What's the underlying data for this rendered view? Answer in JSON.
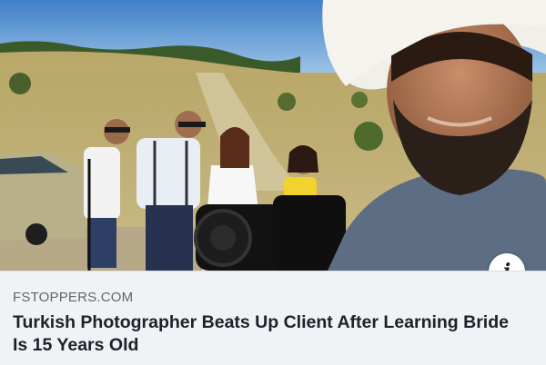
{
  "card": {
    "domain": "FSTOPPERS.COM",
    "headline": "Turkish Photographer Beats Up Client After Learning Bride Is 15 Years Old",
    "info_icon": "i"
  },
  "icons": {
    "info": "info-icon"
  },
  "colors": {
    "background": "#f0f2f5",
    "domain_text": "#606770",
    "headline_text": "#1d2129"
  }
}
